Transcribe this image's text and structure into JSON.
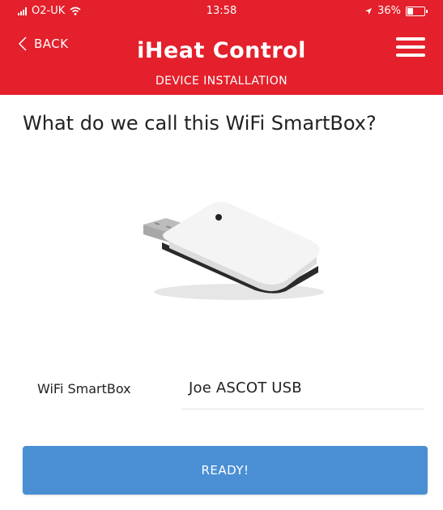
{
  "status_bar": {
    "carrier": "O2-UK",
    "time": "13:58",
    "battery": "36%",
    "battery_level": 0.36
  },
  "header": {
    "back_label": "BACK",
    "title": "iHeat Control",
    "subtitle": "DEVICE INSTALLATION",
    "background_color": "#e3202b"
  },
  "main": {
    "question": "What do we call this WiFi SmartBox?",
    "field_label": "WiFi SmartBox",
    "field_value": "Joe ASCOT USB",
    "ready_label": "READY!",
    "ready_color": "#4a8fd4"
  },
  "icons": [
    "signal-icon",
    "wifi-icon",
    "location-arrow-icon",
    "battery-icon",
    "chevron-left-icon",
    "hamburger-menu-icon"
  ]
}
